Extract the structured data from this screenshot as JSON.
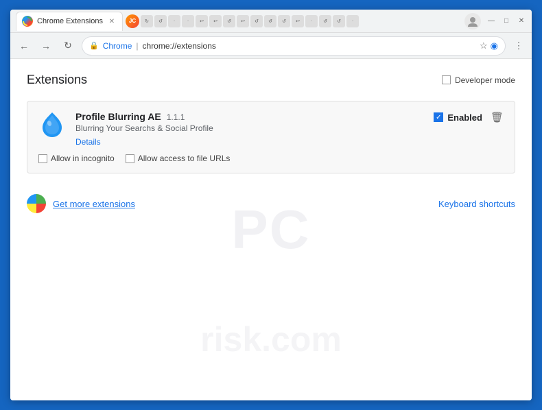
{
  "window": {
    "title": "Chrome Extensions"
  },
  "titlebar": {
    "profile_letter": "JC",
    "profile_bg": "#f44336",
    "window_controls": {
      "minimize": "—",
      "maximize": "□",
      "close": "✕"
    }
  },
  "addressbar": {
    "back_label": "←",
    "forward_label": "→",
    "refresh_label": "↻",
    "lock_icon": "🔒",
    "chrome_label": "Chrome",
    "separator": "|",
    "url": "chrome://extensions",
    "star_icon": "☆",
    "cast_icon": "◉",
    "menu_icon": "⋮"
  },
  "page": {
    "title": "Extensions",
    "developer_mode_label": "Developer mode",
    "watermark1": "PC",
    "watermark2": "risk.com",
    "extension": {
      "name": "Profile Blurring AE",
      "version": "1.1.1",
      "description": "Blurring Your Searchs & Social Profile",
      "details_link": "Details",
      "enabled_label": "Enabled",
      "allow_incognito_label": "Allow in incognito",
      "allow_file_urls_label": "Allow access to file URLs"
    },
    "bottom": {
      "get_more_label": "Get more extensions",
      "keyboard_label": "Keyboard shortcuts"
    }
  }
}
